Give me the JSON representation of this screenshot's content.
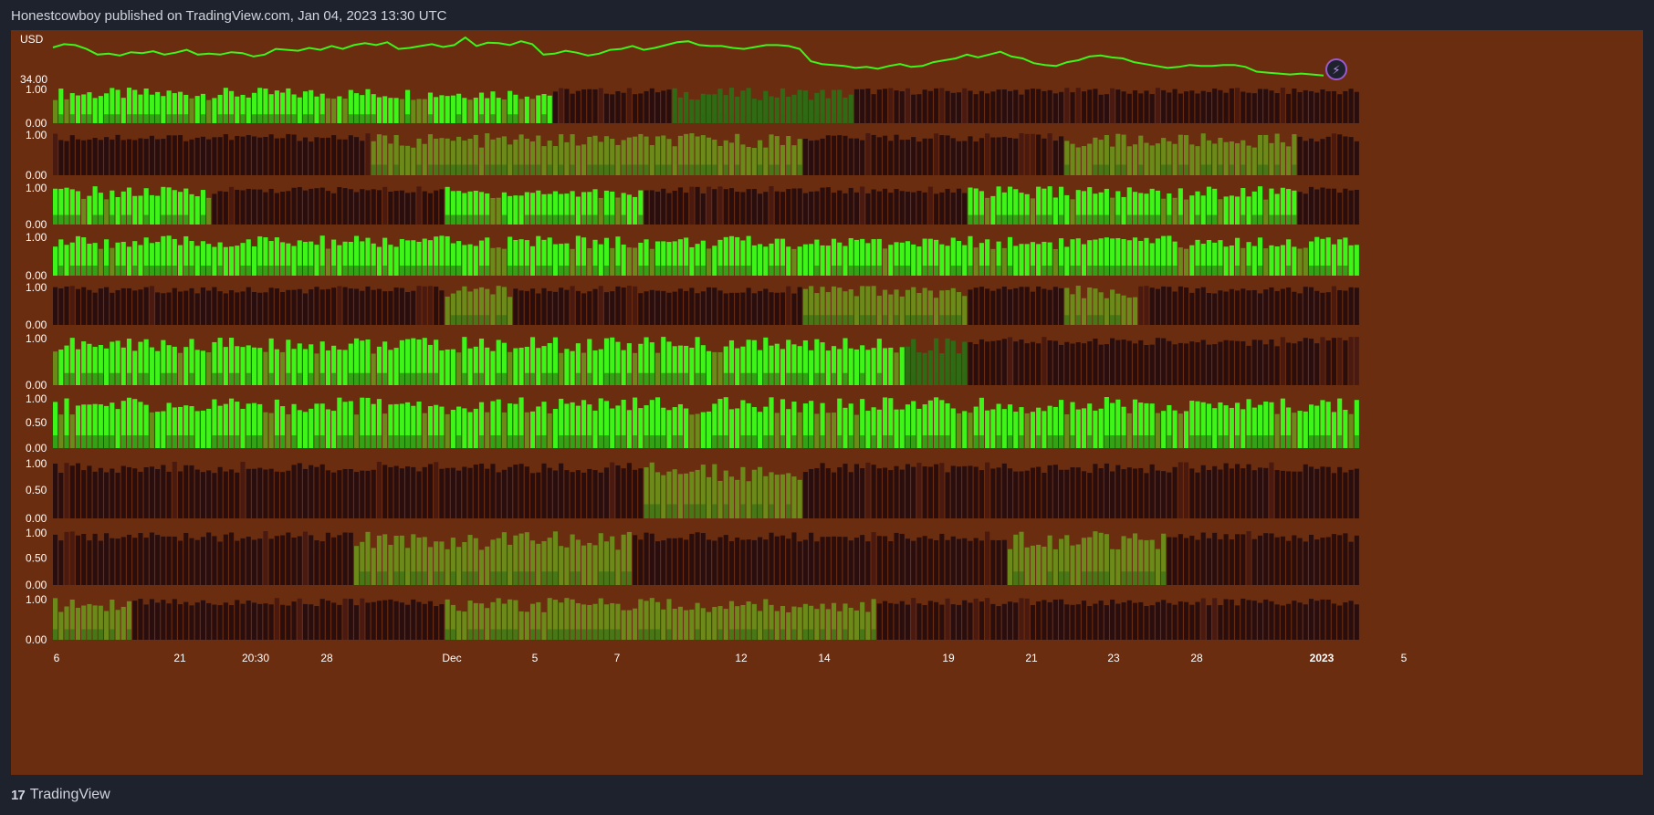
{
  "header": {
    "publish_line": "Honestcowboy published on TradingView.com, Jan 04, 2023 13:30 UTC"
  },
  "footer": {
    "brand": "TradingView",
    "logo_glyph": "17"
  },
  "colors": {
    "background": "#1e222d",
    "chart_bg": "#6b2d10",
    "price_line": "#3ef51a",
    "bright_green": "#3ef51a",
    "olive_green": "#6b8a1a",
    "dark_green": "#2f6a14",
    "dark_maroon": "#2a0d0d"
  },
  "chart_data": {
    "type": "heatmap",
    "title": "",
    "x_tick_labels": [
      "6",
      "21",
      "20:30",
      "28",
      "Dec",
      "5",
      "7",
      "12",
      "14",
      "19",
      "21",
      "23",
      "28",
      "2023",
      "5"
    ],
    "price_panel": {
      "currency_label": "USD",
      "price_label": "34.00",
      "indicator_icon": "lightning-bolt-icon",
      "series": [
        0.75,
        0.82,
        0.8,
        0.72,
        0.6,
        0.62,
        0.58,
        0.65,
        0.63,
        0.67,
        0.6,
        0.64,
        0.7,
        0.6,
        0.62,
        0.6,
        0.65,
        0.63,
        0.56,
        0.6,
        0.72,
        0.7,
        0.68,
        0.74,
        0.7,
        0.78,
        0.72,
        0.8,
        0.84,
        0.8,
        0.86,
        0.72,
        0.74,
        0.78,
        0.82,
        0.76,
        0.8,
        0.96,
        0.78,
        0.85,
        0.84,
        0.8,
        0.88,
        0.82,
        0.6,
        0.62,
        0.68,
        0.64,
        0.58,
        0.62,
        0.7,
        0.72,
        0.78,
        0.7,
        0.74,
        0.8,
        0.86,
        0.88,
        0.8,
        0.78,
        0.78,
        0.74,
        0.72,
        0.76,
        0.8,
        0.8,
        0.78,
        0.72,
        0.46,
        0.4,
        0.38,
        0.36,
        0.32,
        0.34,
        0.3,
        0.36,
        0.4,
        0.34,
        0.36,
        0.44,
        0.48,
        0.52,
        0.6,
        0.54,
        0.6,
        0.66,
        0.56,
        0.52,
        0.42,
        0.38,
        0.36,
        0.44,
        0.48,
        0.56,
        0.58,
        0.54,
        0.52,
        0.44,
        0.4,
        0.36,
        0.32,
        0.34,
        0.38,
        0.36,
        0.36,
        0.38,
        0.38,
        0.34,
        0.24,
        0.22,
        0.2,
        0.18,
        0.2,
        0.18,
        0.16
      ],
      "price_range": [
        0,
        1
      ]
    },
    "panels": [
      {
        "max_label": "1.00",
        "mid_label": "",
        "min_label": "0.00"
      },
      {
        "max_label": "1.00",
        "mid_label": "",
        "min_label": "0.00"
      },
      {
        "max_label": "1.00",
        "mid_label": "",
        "min_label": "0.00"
      },
      {
        "max_label": "1.00",
        "mid_label": "",
        "min_label": "0.00"
      },
      {
        "max_label": "1.00",
        "mid_label": "",
        "min_label": "0.00"
      },
      {
        "max_label": "1.00",
        "mid_label": "",
        "min_label": "0.00"
      },
      {
        "max_label": "1.00",
        "mid_label": "0.50",
        "min_label": "0.00"
      },
      {
        "max_label": "1.00",
        "mid_label": "0.50",
        "min_label": "0.00"
      },
      {
        "max_label": "1.00",
        "mid_label": "0.50",
        "min_label": "0.00"
      },
      {
        "max_label": "1.00",
        "mid_label": "",
        "min_label": "0.00"
      }
    ],
    "panel_regimes": [
      [
        [
          0,
          0.38,
          "g"
        ],
        [
          0.38,
          0.47,
          "m"
        ],
        [
          0.47,
          0.61,
          "dg"
        ],
        [
          0.61,
          1,
          "m"
        ]
      ],
      [
        [
          0,
          0.24,
          "m"
        ],
        [
          0.24,
          0.57,
          "o"
        ],
        [
          0.57,
          0.77,
          "m"
        ],
        [
          0.77,
          0.95,
          "o"
        ],
        [
          0.95,
          1,
          "m"
        ]
      ],
      [
        [
          0,
          0.12,
          "g"
        ],
        [
          0.12,
          0.3,
          "m"
        ],
        [
          0.3,
          0.45,
          "g"
        ],
        [
          0.45,
          0.7,
          "m"
        ],
        [
          0.7,
          0.95,
          "g"
        ],
        [
          0.95,
          1,
          "m"
        ]
      ],
      [
        [
          0,
          1,
          "g"
        ]
      ],
      [
        [
          0,
          0.3,
          "m"
        ],
        [
          0.3,
          0.35,
          "o"
        ],
        [
          0.35,
          0.57,
          "m"
        ],
        [
          0.57,
          0.7,
          "o"
        ],
        [
          0.7,
          0.77,
          "m"
        ],
        [
          0.77,
          0.83,
          "o"
        ],
        [
          0.83,
          1,
          "m"
        ]
      ],
      [
        [
          0,
          0.2,
          "g"
        ],
        [
          0.2,
          0.45,
          "g"
        ],
        [
          0.45,
          0.65,
          "g"
        ],
        [
          0.65,
          0.7,
          "dg"
        ],
        [
          0.7,
          1,
          "m"
        ]
      ],
      [
        [
          0,
          1,
          "g"
        ]
      ],
      [
        [
          0,
          0.45,
          "m"
        ],
        [
          0.45,
          0.57,
          "o"
        ],
        [
          0.57,
          1,
          "m"
        ]
      ],
      [
        [
          0,
          0.23,
          "m"
        ],
        [
          0.23,
          0.44,
          "o"
        ],
        [
          0.44,
          0.73,
          "m"
        ],
        [
          0.73,
          0.85,
          "o"
        ],
        [
          0.85,
          1,
          "m"
        ]
      ],
      [
        [
          0,
          0.06,
          "o"
        ],
        [
          0.06,
          0.3,
          "m"
        ],
        [
          0.3,
          0.63,
          "o"
        ],
        [
          0.63,
          1,
          "m"
        ]
      ]
    ]
  }
}
